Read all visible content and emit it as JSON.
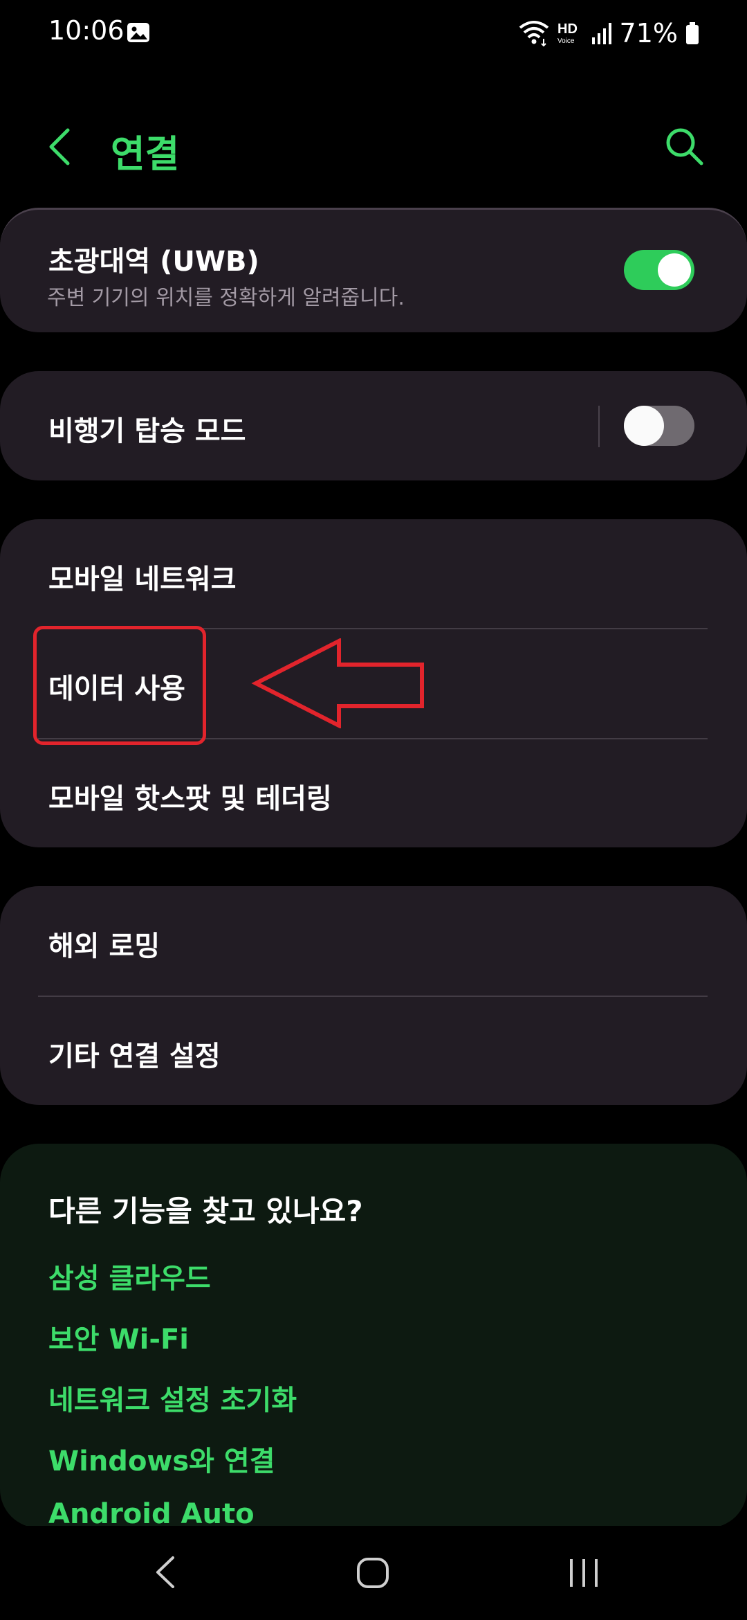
{
  "status_bar": {
    "time": "10:06",
    "hd_label": "HD",
    "voice_label": "Voice",
    "battery": "71%"
  },
  "header": {
    "title": "연결"
  },
  "uwb": {
    "title": "초광대역 (UWB)",
    "subtitle": "주변 기기의 위치를 정확하게 알려줍니다.",
    "enabled": true
  },
  "airplane": {
    "title": "비행기 탑승 모드",
    "enabled": false
  },
  "network_group": {
    "items": [
      {
        "label": "모바일 네트워크"
      },
      {
        "label": "데이터 사용"
      },
      {
        "label": "모바일 핫스팟 및 테더링"
      }
    ]
  },
  "roaming_group": {
    "items": [
      {
        "label": "해외 로밍"
      },
      {
        "label": "기타 연결 설정"
      }
    ]
  },
  "suggestions": {
    "title": "다른 기능을 찾고 있나요?",
    "links": [
      {
        "label": "삼성 클라우드"
      },
      {
        "label": "보안 Wi-Fi"
      },
      {
        "label": "네트워크 설정 초기화"
      },
      {
        "label": "Windows와 연결"
      },
      {
        "label": "Android Auto"
      }
    ]
  },
  "colors": {
    "accent": "#3ddc6a",
    "card": "#221c24",
    "annotation": "#e2242c"
  }
}
